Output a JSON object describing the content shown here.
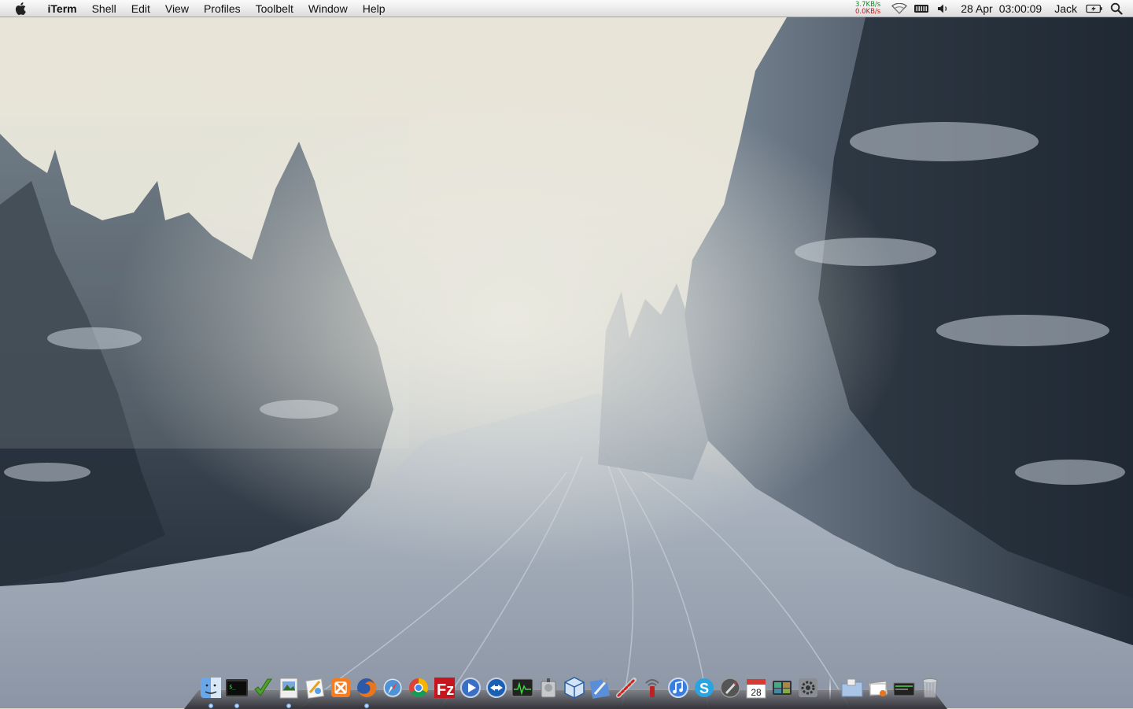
{
  "menubar": {
    "app_name": "iTerm",
    "items": [
      "Shell",
      "Edit",
      "View",
      "Profiles",
      "Toolbelt",
      "Window",
      "Help"
    ],
    "status": {
      "net_up": "3.7KB/s",
      "net_down": "0.0KB/s",
      "date": "28 Apr",
      "time": "03:00:09",
      "user": "Jack"
    }
  },
  "dock": {
    "apps": [
      {
        "name": "finder-icon"
      },
      {
        "name": "iterm-icon"
      },
      {
        "name": "textwrangler-icon"
      },
      {
        "name": "preview-icon"
      },
      {
        "name": "script-editor-icon"
      },
      {
        "name": "xampp-icon"
      },
      {
        "name": "firefox-icon"
      },
      {
        "name": "safari-icon"
      },
      {
        "name": "chrome-icon"
      },
      {
        "name": "filezilla-icon"
      },
      {
        "name": "quicktime-icon"
      },
      {
        "name": "teamviewer-icon"
      },
      {
        "name": "activity-monitor-icon"
      },
      {
        "name": "disk-utility-icon"
      },
      {
        "name": "virtualbox-icon"
      },
      {
        "name": "xcode-icon"
      },
      {
        "name": "network-utility-icon"
      },
      {
        "name": "airport-utility-icon"
      },
      {
        "name": "itunes-icon"
      },
      {
        "name": "skype-icon"
      },
      {
        "name": "launchpad-icon"
      },
      {
        "name": "calendar-icon"
      },
      {
        "name": "app-store-icon"
      },
      {
        "name": "system-preferences-icon"
      }
    ],
    "calendar_day": "28",
    "stacks": [
      {
        "name": "applications-stack-icon"
      },
      {
        "name": "documents-stack-icon"
      },
      {
        "name": "downloads-stack-icon"
      },
      {
        "name": "trash-icon"
      }
    ],
    "colors": {
      "firefox": "#e8761f",
      "filezilla": "#c6151c",
      "chrome_red": "#db4437",
      "chrome_green": "#0f9d58",
      "chrome_yellow": "#f4b400",
      "skype": "#2aa4e0",
      "itunes": "#3a7fe0"
    }
  }
}
